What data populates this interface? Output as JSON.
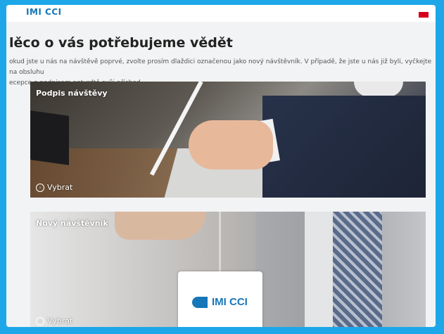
{
  "header": {
    "logo_text": "IMI CCI"
  },
  "main": {
    "title": "lěco o vás potřebujeme vědět",
    "instructions_line1": "okud jste u nás na návštěvě poprvé, zvolte prosím dlaždici označenou jako nový návštěvník. V případě, že jste u nás již byli, vyčkejte na obsluhu",
    "instructions_line2": "ecepce a podpisem potvrdtě svůj příchod."
  },
  "tiles": [
    {
      "title": "Podpis návštěvy",
      "action_label": "Vybrat",
      "action_icon": "chevron-circle-icon"
    },
    {
      "title": "Nový návštěvník",
      "action_label": "Vybrat",
      "action_icon": "chevron-circle-icon",
      "badge_text": "IMI CCI"
    }
  ],
  "colors": {
    "frame_border": "#1ea7e8",
    "brand": "#1676b8"
  }
}
